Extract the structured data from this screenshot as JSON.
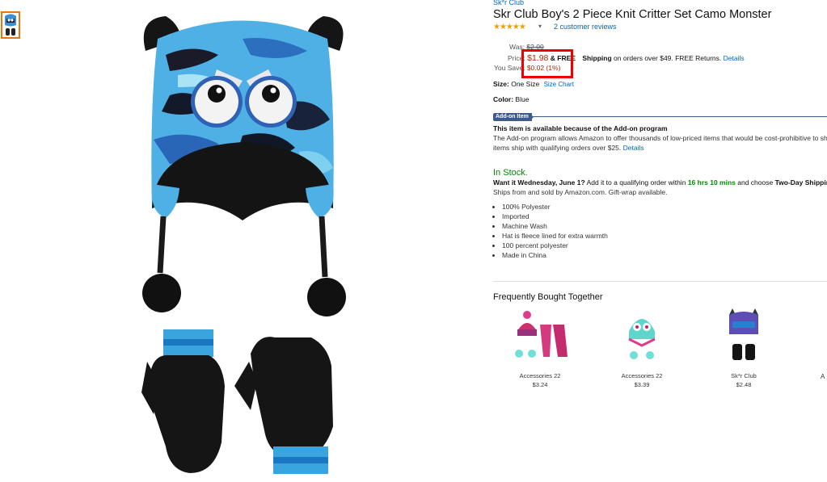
{
  "product": {
    "brand": "Sk*r Club",
    "title": "Skr Club Boy's 2 Piece Knit Critter Set Camo Monster",
    "rating_stars": "★★★★★",
    "reviews_link": "2 customer reviews"
  },
  "pricing": {
    "was_label": "Was:",
    "was_value": "$2.00",
    "price_label": "Price:",
    "price_value": "$1.98",
    "free_prefix": "& FREE",
    "shipping_bold": "Shipping",
    "shipping_text": "on orders over $49. FREE Returns.",
    "details_link": "Details",
    "save_label": "You Save:",
    "save_value": "$0.02 (1%)"
  },
  "size": {
    "label": "Size:",
    "value": "One Size",
    "chart_link": "Size Chart"
  },
  "color": {
    "label": "Color:",
    "value": "Blue"
  },
  "addon": {
    "badge": "Add-on Item",
    "heading": "This item is available because of the Add-on program",
    "desc_line1": "The Add-on program allows Amazon to offer thousands of low-priced items that would be cost-prohibitive to sh",
    "desc_line2": "items ship with qualifying orders over $25.",
    "details_link": "Details"
  },
  "availability": {
    "status": "In Stock.",
    "want_bold": "Want it Wednesday, June 1?",
    "want_text": "Add it to a qualifying order within",
    "time_left": "16 hrs 10 mins",
    "choose_text": "and choose",
    "shipping_option": "Two-Day Shippin",
    "ships_from": "Ships from and sold by Amazon.com. Gift-wrap available."
  },
  "features": [
    "100% Polyester",
    "Imported",
    "Machine Wash",
    "Hat is fleece lined for extra warmth",
    "100 percent polyester",
    "Made in China"
  ],
  "fbt": {
    "title": "Frequently Bought Together",
    "items": [
      {
        "name": "Accessories 22",
        "price": "$3.24"
      },
      {
        "name": "Accessories 22",
        "price": "$3.39"
      },
      {
        "name": "Sk*r Club",
        "price": "$2.48"
      }
    ],
    "partial": "A"
  },
  "colors": {
    "link": "#0066c0",
    "price_red": "#b12704",
    "stock_green": "#008a00",
    "highlight_red": "#ee0000",
    "addon_navy": "#3d5a8c",
    "thumb_border": "#e47911"
  }
}
